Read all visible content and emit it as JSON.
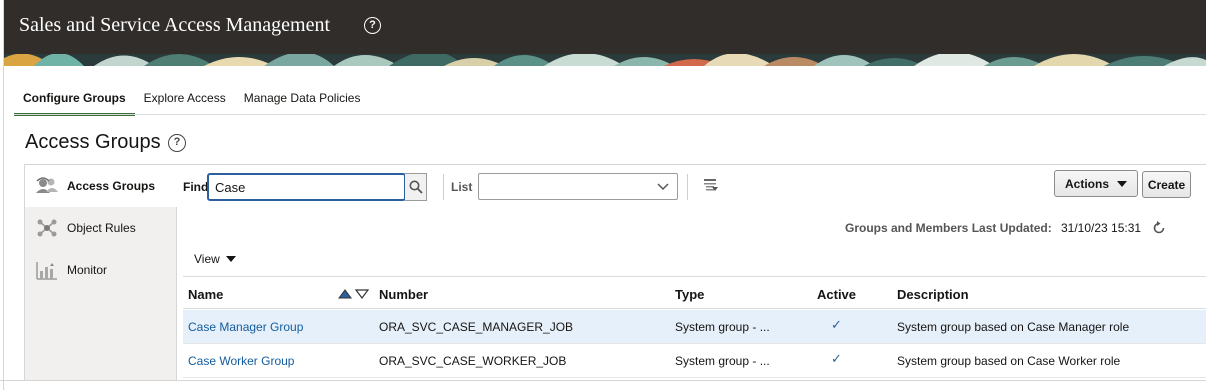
{
  "app": {
    "title": "Sales and Service Access Management",
    "help_icon": "question-circle-icon"
  },
  "tabs": [
    {
      "label": "Configure Groups",
      "active": true
    },
    {
      "label": "Explore Access",
      "active": false
    },
    {
      "label": "Manage Data Policies",
      "active": false
    }
  ],
  "page": {
    "title": "Access Groups"
  },
  "sidebar": {
    "items": [
      {
        "label": "Access Groups",
        "icon": "access-groups-icon",
        "active": true
      },
      {
        "label": "Object Rules",
        "icon": "object-rules-icon",
        "active": false
      },
      {
        "label": "Monitor",
        "icon": "monitor-chart-icon",
        "active": false
      }
    ]
  },
  "toolbar": {
    "find_label": "Find",
    "find_value": "Case",
    "list_label": "List",
    "list_value": "",
    "actions_label": "Actions",
    "create_label": "Create"
  },
  "status": {
    "updated_label": "Groups and Members Last Updated:",
    "updated_value": "31/10/23 15:31"
  },
  "view_label": "View",
  "table": {
    "columns": [
      "Name",
      "Number",
      "Type",
      "Active",
      "Description"
    ],
    "rows": [
      {
        "name": "Case Manager Group",
        "number": "ORA_SVC_CASE_MANAGER_JOB",
        "type": "System group - ...",
        "active": "✓",
        "description": "System group based on Case Manager role",
        "selected": true
      },
      {
        "name": "Case Worker Group",
        "number": "ORA_SVC_CASE_WORKER_JOB",
        "type": "System group - ...",
        "active": "✓",
        "description": "System group based on Case Worker role",
        "selected": false
      }
    ]
  },
  "colors": {
    "header_bg": "#312d2a",
    "active_tab_underline": "#3a6f3a",
    "link": "#145c9e",
    "selected_row": "#e6f0fa",
    "focus_border": "#2c5f9e"
  }
}
